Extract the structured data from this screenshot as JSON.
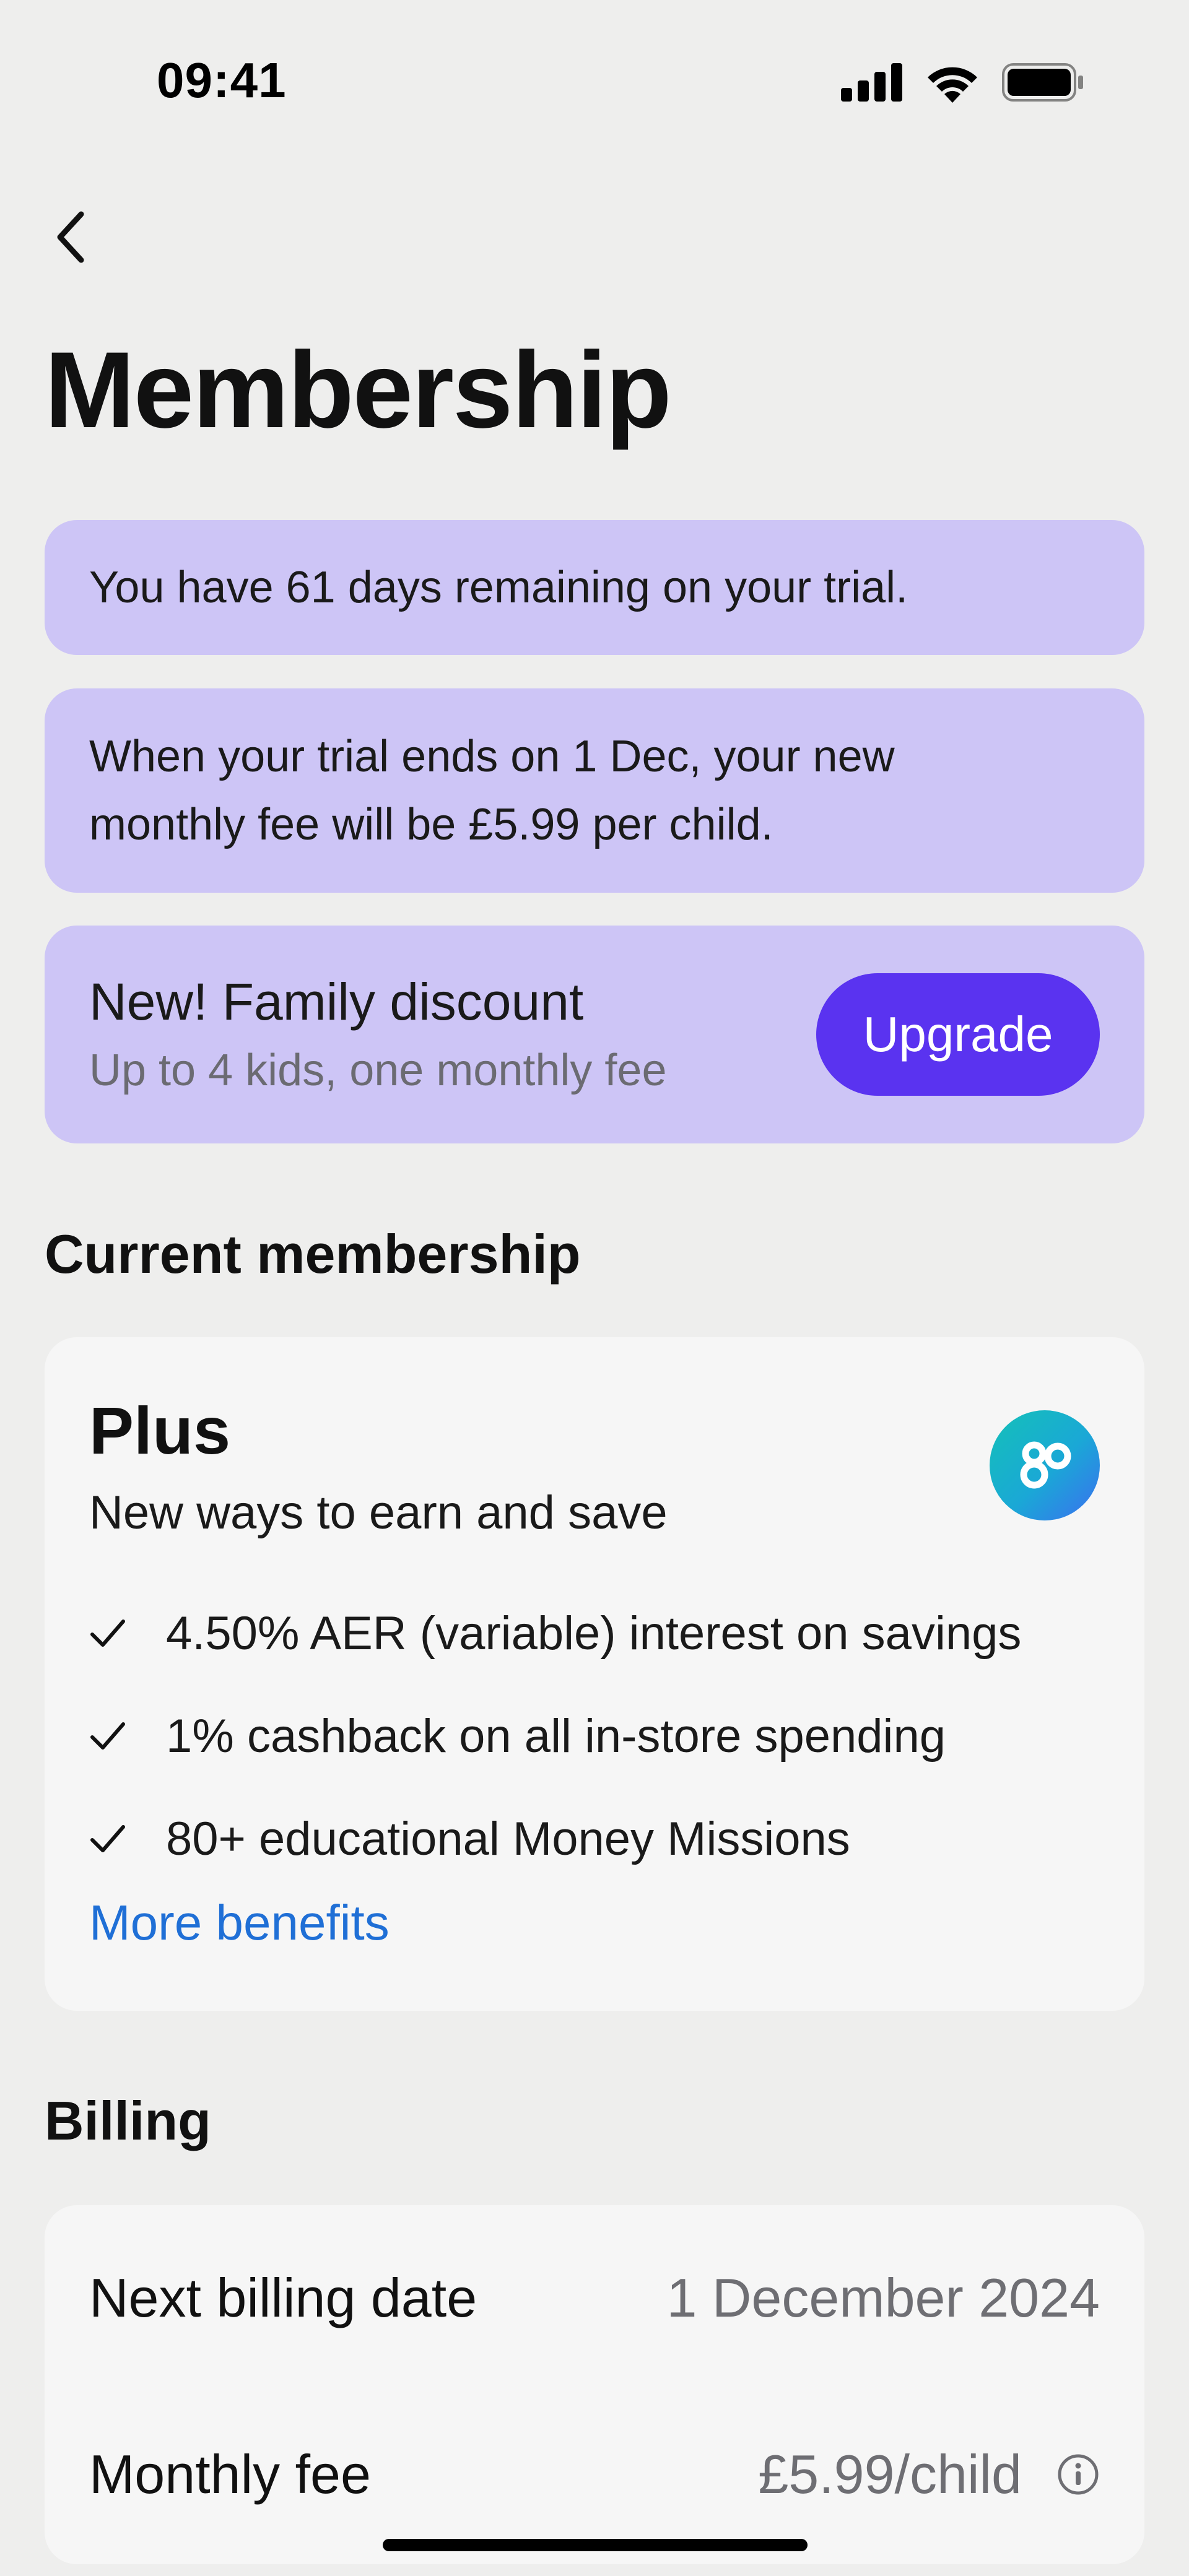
{
  "status_bar": {
    "time": "09:41"
  },
  "page": {
    "title": "Membership"
  },
  "notices": {
    "trial_remaining": "You have 61 days remaining on your trial.",
    "trial_ends_line1": "When your trial ends on 1 Dec, your new",
    "trial_ends_line2": "monthly fee will be £5.99 per child."
  },
  "promo": {
    "title": "New! Family discount",
    "subtitle": "Up to 4 kids, one monthly fee",
    "button_label": "Upgrade"
  },
  "current_membership": {
    "section_title": "Current membership",
    "plan_name": "Plus",
    "tagline": "New ways to earn and save",
    "benefits": [
      "4.50% AER (variable) interest on savings",
      "1% cashback on all in-store spending",
      "80+ educational Money Missions"
    ],
    "more_link": "More benefits"
  },
  "billing": {
    "section_title": "Billing",
    "next_billing_label": "Next billing date",
    "next_billing_value": "1 December 2024",
    "monthly_fee_label": "Monthly fee",
    "monthly_fee_value": "£5.99/child"
  },
  "colors": {
    "background": "#eeeeed",
    "notice_bg": "#cdc5f6",
    "accent_button": "#5a33f0",
    "link": "#1f6fd6",
    "card_bg": "#f6f6f6"
  },
  "icons": [
    "signal-icon",
    "wifi-icon",
    "battery-icon",
    "back-chevron-icon",
    "plan-logo-icon",
    "check-icon",
    "info-icon"
  ]
}
